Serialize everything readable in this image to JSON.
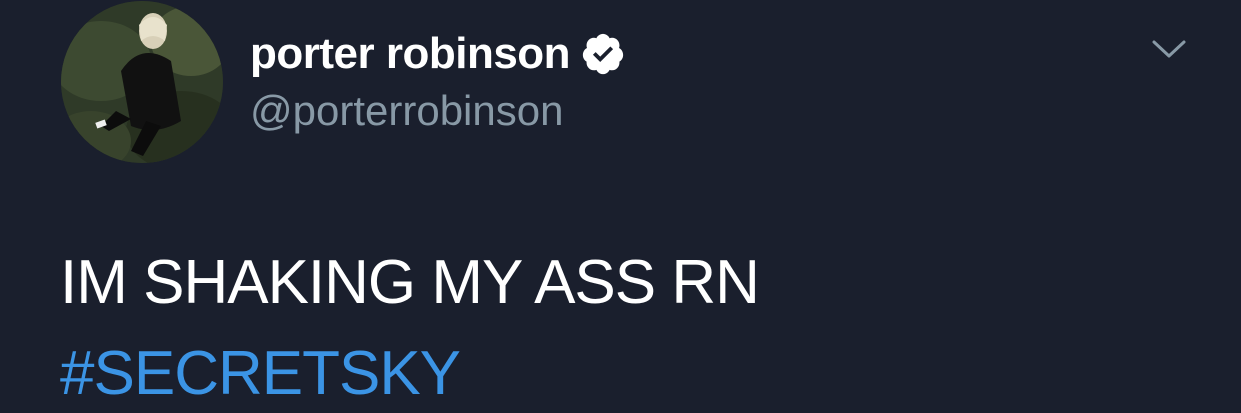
{
  "tweet": {
    "author": {
      "display_name": "porter robinson",
      "handle": "@porterrobinson",
      "verified": true
    },
    "text": "IM SHAKING MY ASS RN",
    "hashtag": "#SECRETSKY"
  },
  "icons": {
    "verified": "verified-badge-icon",
    "menu": "chevron-down-icon"
  },
  "colors": {
    "background": "#1a1f2d",
    "primary_text": "#ffffff",
    "secondary_text": "#8899a6",
    "link": "#3b94e5"
  }
}
